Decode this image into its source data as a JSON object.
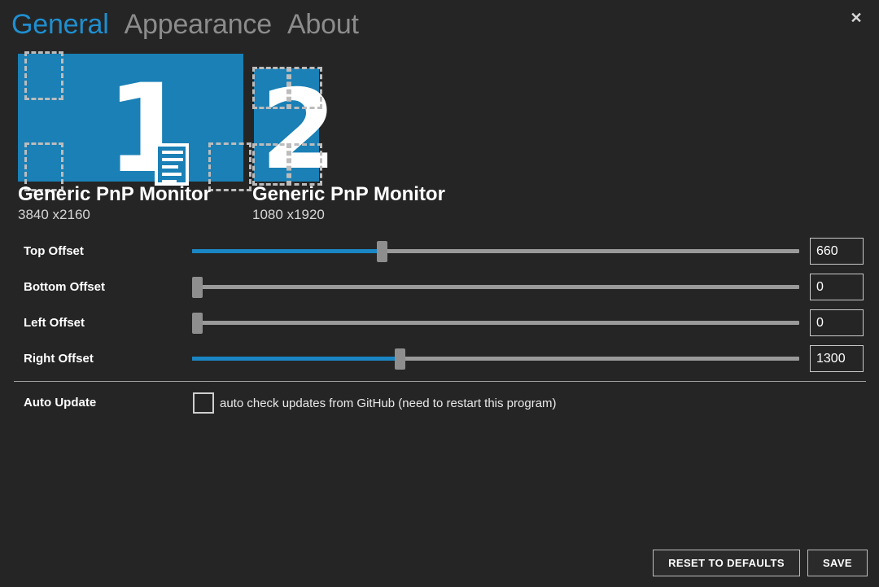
{
  "window": {
    "close_label": "✕"
  },
  "tabs": [
    {
      "label": "General",
      "active": true
    },
    {
      "label": "Appearance",
      "active": false
    },
    {
      "label": "About",
      "active": false
    }
  ],
  "monitors": [
    {
      "number": "1",
      "name": "Generic PnP Monitor",
      "resolution": "3840 x2160"
    },
    {
      "number": "2",
      "name": "Generic PnP Monitor",
      "resolution": "1080 x1920"
    }
  ],
  "offsets": [
    {
      "label": "Top Offset",
      "value": "660",
      "fill_percent": 31
    },
    {
      "label": "Bottom Offset",
      "value": "0",
      "fill_percent": 0
    },
    {
      "label": "Left Offset",
      "value": "0",
      "fill_percent": 0
    },
    {
      "label": "Right Offset",
      "value": "1300",
      "fill_percent": 34
    }
  ],
  "auto_update": {
    "label": "Auto Update",
    "checkbox_text": "auto check updates from GitHub (need to restart this program)",
    "checked": false
  },
  "footer": {
    "reset_label": "RESET TO DEFAULTS",
    "save_label": "SAVE"
  },
  "colors": {
    "background": "#252525",
    "accent_blue": "#1f8fd0",
    "monitor_blue": "#1a80b6",
    "slider_fill": "#1a86c4",
    "slider_track": "#9a9a9a",
    "inactive_tab": "#8c8c8c"
  }
}
